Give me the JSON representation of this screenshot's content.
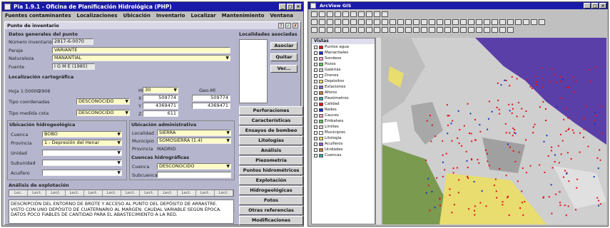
{
  "left_window": {
    "title": "Pia 1.9.1 - Oficina de Planificación Hidrológica (PHP)",
    "menu": [
      "Fuentes contaminantes",
      "Localizaciones",
      "Ubicación",
      "Inventario",
      "Localizar",
      "Mantenimiento",
      "Ventana"
    ],
    "form_title": "Punto de inventario",
    "icons_right": [
      "?",
      "✓",
      "✗"
    ],
    "sec_datos": "Datos generales del punto",
    "lbl_numero": "Número inventario",
    "val_numero": "2817-6-0070",
    "lbl_paraje": "Paraje",
    "val_paraje": "VARIANTE",
    "lbl_naturaleza": "Naturaleza",
    "val_naturaleza": "MANANTIAL",
    "lbl_fuente": "Fuente",
    "val_fuente": "I G M E (1985)",
    "sec_cartografia": "Localización cartográfica",
    "lbl_hoja": "Hoja 1:50000",
    "val_hoja": "2906",
    "lbl_huso": "Huso",
    "val_huso": "30",
    "lbl_geo": "Geo-Ml",
    "lbl_x": "X",
    "val_x": "509774",
    "val_x2": "509774",
    "lbl_y": "Y",
    "val_y": "4369471",
    "val_y2": "4369471",
    "lbl_z": "Z",
    "val_z": "611",
    "lbl_tipo_coord": "Tipo coordenadas",
    "val_tipo_coord": "DESCONOCIDO",
    "lbl_tipo_cota": "Tipo medida cota",
    "val_tipo_cota": "DESCONOCIDO",
    "sec_hidro": "Ubicación hidrogeológica",
    "lbl_cuenca": "Cuenca",
    "val_cuenca": "BOBO",
    "lbl_provincia": "Provincia",
    "val_provincia": "1 - Depresión del Henar",
    "lbl_unidad": "Unidad",
    "val_unidad": "",
    "lbl_subunidad": "Subunidad",
    "val_subunidad": "",
    "lbl_acuifero": "Acuífero",
    "val_acuifero": "",
    "sec_admin": "Ubicación administrativa",
    "lbl_localidad": "Localidad",
    "val_localidad": "SIERRA",
    "lbl_municipio": "Municipio",
    "val_municipio": "SOMOSIERRA (1.4)",
    "lbl_provincia2": "Provincia",
    "val_provincia2": "MADRID",
    "sec_cuencas": "Cuencas hidrográficas",
    "lbl_cuenca2": "Cuenca",
    "val_cuenca2": "DESCONOCIDO",
    "lbl_subcuenca": "Subcuenca",
    "val_subcuenca": "",
    "sec_analisis": "Análisis de explotación",
    "grid_cols": [
      "Lec.",
      "Lect.",
      "Lect.",
      "Lect.",
      "Lect.",
      "Lect.",
      "Lect.",
      "Lect.",
      "Lect.",
      "Lect.",
      "Lect.",
      "Lect."
    ],
    "memo_text": "DESCRIPCIÓN DEL ENTORNO DE BROTE Y ACCESO AL PUNTO DEL DEPÓSITO DE ARRASTRE. VISTO CON UNO DEPÓSITO DE CUATERNARIO AL MARGEN. CAUDAL VARIABLE SEGÚN ÉPOCA. DATOS POCO FIABLES DE CANTIDAD PARA EL ABASTECIMIENTO A LA RED.",
    "sec_lista": "Localidades asociadas",
    "btn_asociar": "Asociar",
    "btn_quitar": "Quitar",
    "btn_ver": "Ver...",
    "side_buttons": [
      "Perforaciones",
      "Características",
      "Ensayos de bombeo",
      "Litologías",
      "Análisis",
      "Piezometría",
      "Puntos hidrométricos",
      "Explotación",
      "Hidrogeológicas",
      "Fotos",
      "Otras referencias",
      "Modificaciones"
    ]
  },
  "right_window": {
    "title": "ArcView GIS",
    "legend_header": "Vistas",
    "legend_items": [
      "Puntos agua",
      "Manantiales",
      "Sondeos",
      "Pozos",
      "Galerías",
      "Drenes",
      "Depósitos",
      "Estaciones",
      "Aforos",
      "Piezómetros",
      "Calidad",
      "Redes",
      "Cauces",
      "Embalses",
      "Límites",
      "Municipios",
      "Litología",
      "Acuíferos",
      "Unidades",
      "Cuencas"
    ],
    "colors": {
      "map_bg": "#cfcfcf",
      "sea": "#5a3fa8",
      "green": "#7a9a50",
      "yellow": "#e8dd6e",
      "points_red": "#e0101a",
      "points_blue": "#1a2fd0"
    }
  }
}
